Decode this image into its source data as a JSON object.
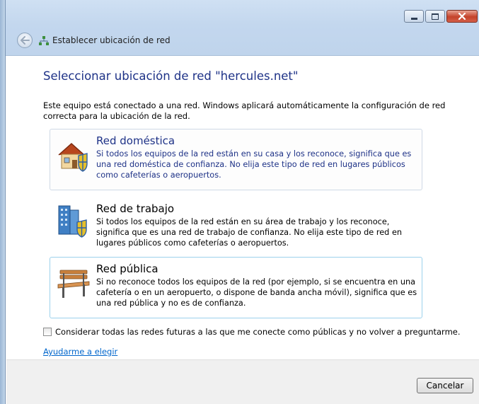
{
  "window": {
    "title": "Establecer ubicación de red"
  },
  "main": {
    "heading": "Seleccionar ubicación de red \"hercules.net\"",
    "description": "Este equipo está conectado a una red. Windows aplicará automáticamente la configuración de red correcta para la ubicación de la red.",
    "options": [
      {
        "title": "Red doméstica",
        "description": "Si todos los equipos de la red están en su casa y los reconoce, significa que es una red doméstica de confianza. No elija este tipo de red en lugares públicos como cafeterías o aeropuertos.",
        "icon": "home-network-icon"
      },
      {
        "title": "Red de trabajo",
        "description": "Si todos los equipos de la red están en su área de trabajo y los reconoce, significa que es una red de trabajo de confianza. No elija este tipo de red en lugares públicos como cafeterías o aeropuertos.",
        "icon": "work-network-icon"
      },
      {
        "title": "Red pública",
        "description": "Si no reconoce todos los equipos de la red (por ejemplo, si se encuentra en una cafetería o en un aeropuerto, o dispone de banda ancha móvil), significa que es una red pública y no es de confianza.",
        "icon": "public-network-icon"
      }
    ],
    "checkbox_label": "Considerar todas las redes futuras a las que me conecte como públicas y no volver a preguntarme.",
    "checkbox_checked": false,
    "help_link": "Ayudarme a elegir"
  },
  "footer": {
    "cancel_label": "Cancelar"
  },
  "colors": {
    "heading_blue": "#1e3287",
    "link_blue": "#0066cc",
    "close_red": "#c4422a"
  }
}
